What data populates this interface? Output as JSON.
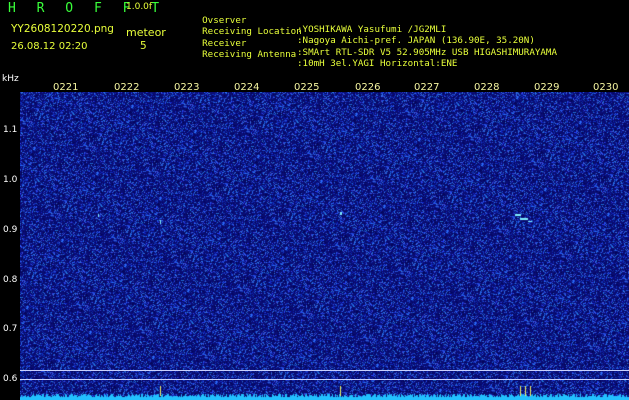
{
  "header": {
    "logo": "H R O F F T",
    "version": "1.0.0f",
    "filename": "YY2608120220.png",
    "timestamp": "26.08.12 02:20",
    "meteor_label": "meteor",
    "meteor_count": "5"
  },
  "info": [
    {
      "label": "Ovserver",
      "value": ":YOSHIKAWA Yasufumi /JG2MLI"
    },
    {
      "label": "Receiving Location",
      "value": ":Nagoya Aichi-pref. JAPAN (136.90E, 35.20N)"
    },
    {
      "label": "Receiver",
      "value": ":SMArt RTL-SDR V5 52.905MHz USB HIGASHIMURAYAMA"
    },
    {
      "label": "Receiving Antenna",
      "value": ":10mH 3el.YAGI Horizontal:ENE"
    }
  ],
  "axis": {
    "unit": "kHz",
    "y_ticks": [
      "1.1",
      "1.0",
      "0.9",
      "0.8",
      "0.7",
      "0.6"
    ],
    "x_ticks": [
      "0221",
      "0222",
      "0223",
      "0224",
      "0225",
      "0226",
      "0227",
      "0228",
      "0229",
      "0230"
    ]
  },
  "colors": {
    "background": "#0a0d74",
    "noise": "#2a6bff",
    "signal": "#7ff0ff",
    "baseline": "#22c0ff",
    "marker": "#f0f060"
  }
}
